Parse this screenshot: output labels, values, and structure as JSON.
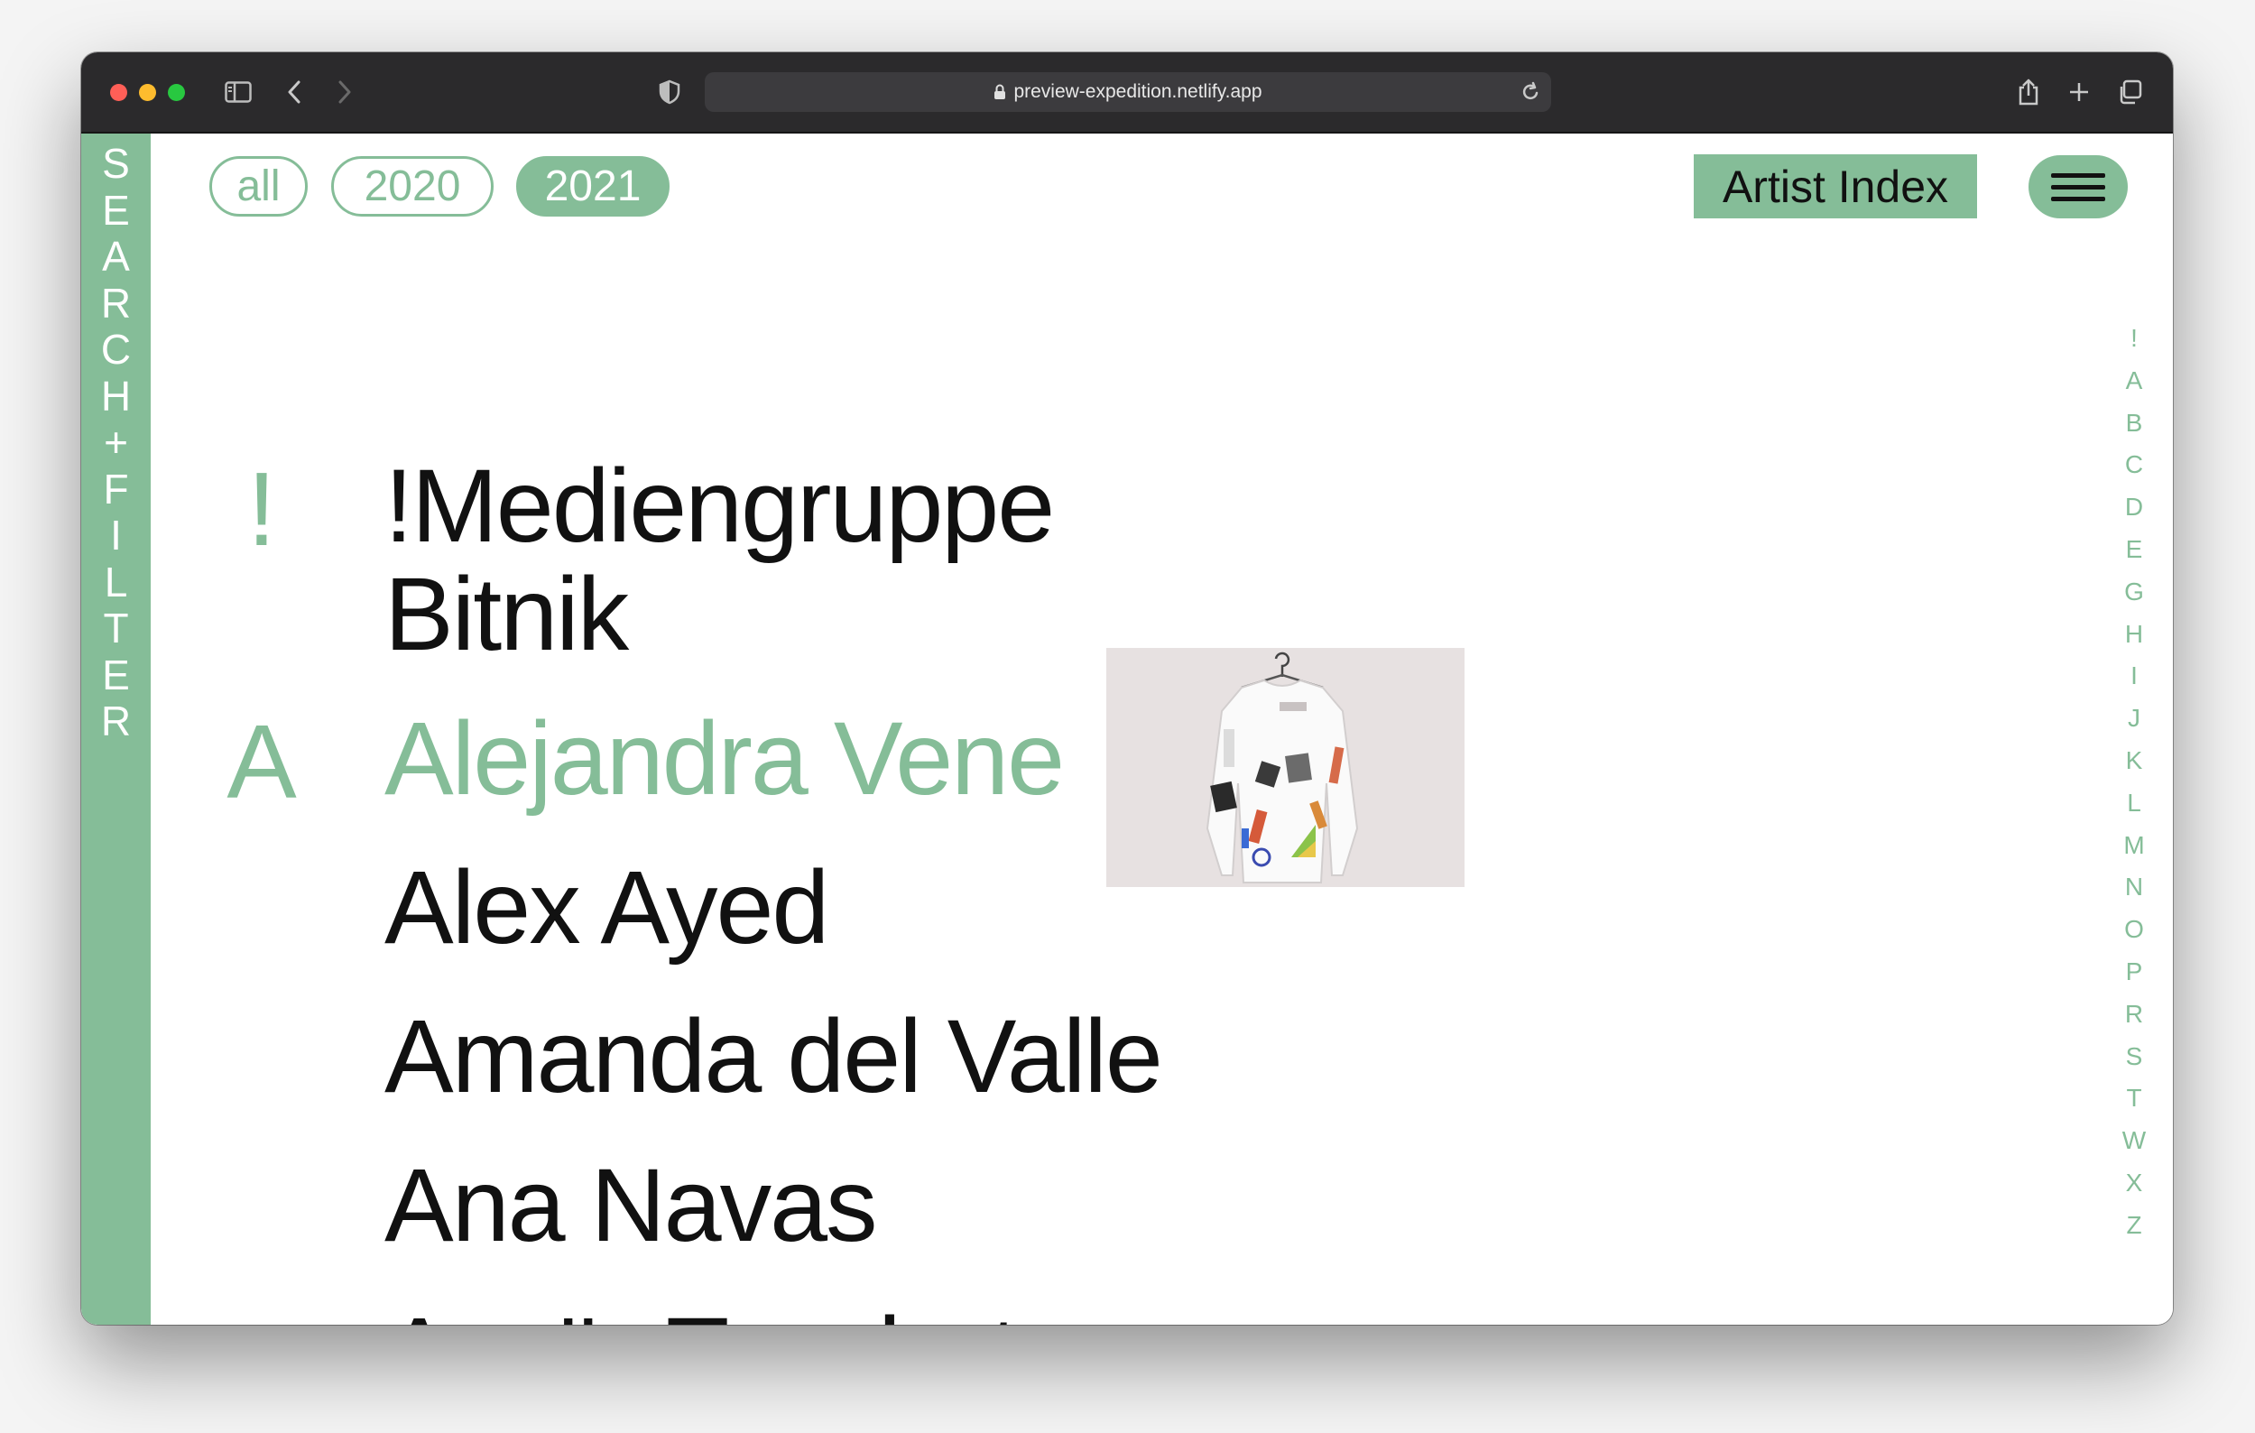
{
  "browser": {
    "url": "preview-expedition.netlify.app"
  },
  "sidebar": {
    "label_letters": [
      "S",
      "E",
      "A",
      "R",
      "C",
      "H",
      "+",
      "F",
      "I",
      "L",
      "T",
      "E",
      "R"
    ]
  },
  "filters": {
    "all": "all",
    "y2020": "2020",
    "y2021": "2021",
    "active": "2021"
  },
  "header": {
    "artist_index": "Artist Index"
  },
  "alphabet": [
    "!",
    "A",
    "B",
    "C",
    "D",
    "E",
    "G",
    "H",
    "I",
    "J",
    "K",
    "L",
    "M",
    "N",
    "O",
    "P",
    "R",
    "S",
    "T",
    "W",
    "X",
    "Z"
  ],
  "sections": [
    {
      "letter": "!",
      "artists": [
        "!Mediengruppe Bitnik"
      ]
    },
    {
      "letter": "A",
      "artists": [
        "Alejandra Venegas",
        "Alex Ayed",
        "Amanda del Valle",
        "Ana Navas",
        "Anaïs Touchot"
      ]
    }
  ],
  "artists_display": {
    "mediengruppe_line1": "!Mediengruppe",
    "mediengruppe_line2": "Bitnik",
    "alejandra": "Alejandra Vene",
    "alex": "Alex Ayed",
    "amanda": "Amanda del Valle",
    "ana": "Ana Navas",
    "anais": "Anaïs Touchot"
  },
  "hovered_artist": "Alejandra Venegas",
  "colors": {
    "accent": "#85bd98",
    "text": "#111111",
    "toolbar": "#2b2a2c"
  }
}
